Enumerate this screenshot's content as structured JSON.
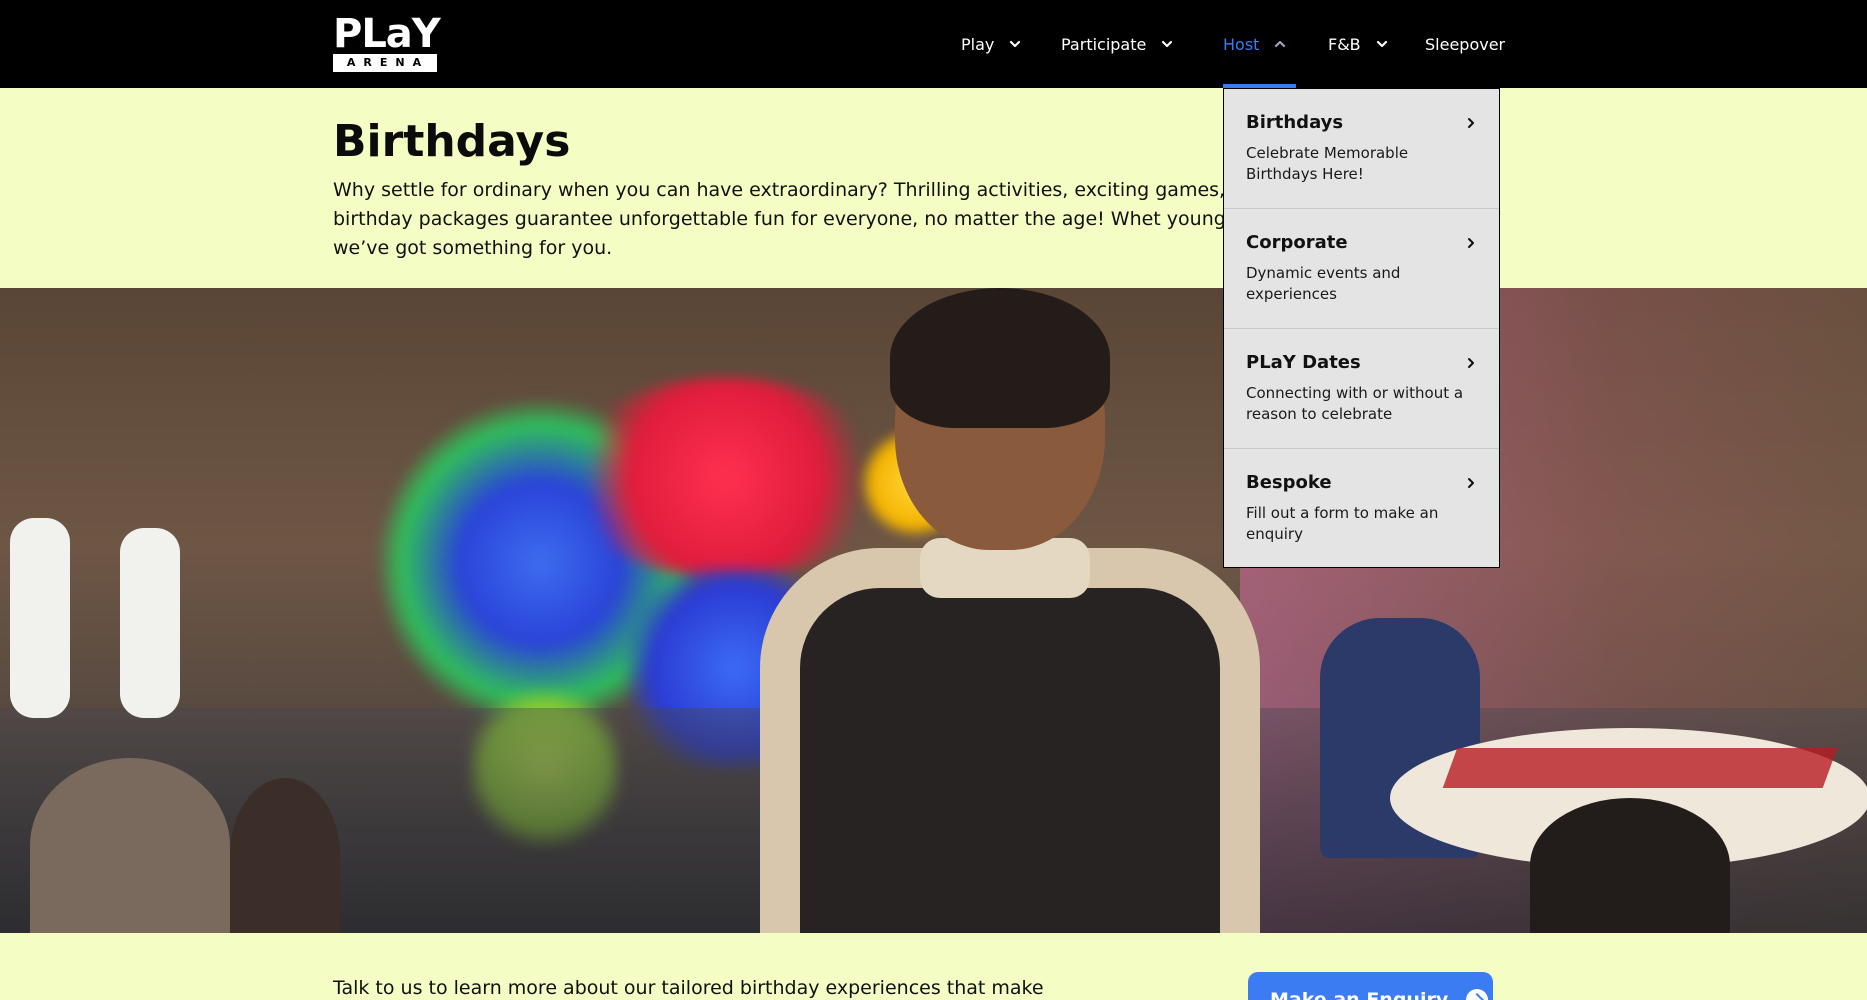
{
  "brand": {
    "logo_word": "PLaY",
    "logo_sub": "ARENA",
    "accent_color": "#3c7cf2",
    "background_color": "#f3fdc4",
    "header_color": "#000000"
  },
  "nav": {
    "items": [
      {
        "label": "Play",
        "has_dropdown": true,
        "active": false
      },
      {
        "label": "Participate",
        "has_dropdown": true,
        "active": false
      },
      {
        "label": "Host",
        "has_dropdown": true,
        "active": true
      },
      {
        "label": "F&B",
        "has_dropdown": true,
        "active": false
      },
      {
        "label": "Sleepover",
        "has_dropdown": false,
        "active": false
      }
    ]
  },
  "host_menu": {
    "items": [
      {
        "title": "Birthdays",
        "description": "Celebrate Memorable Birthdays Here!",
        "icon": "chevron-right-icon"
      },
      {
        "title": "Corporate",
        "description": "Dynamic events and experiences",
        "icon": "chevron-right-icon"
      },
      {
        "title": "PLaY Dates",
        "description": "Connecting with or without a reason to celebrate",
        "icon": "chevron-right-icon"
      },
      {
        "title": "Bespoke",
        "description": "Fill out a form to make an enquiry",
        "icon": "chevron-right-icon"
      }
    ]
  },
  "page": {
    "title": "Birthdays",
    "intro": "Why settle for ordinary when you can have extraordinary? Thrilling activities, exciting games, and d—our custom birthday packages guarantee unforgettable fun for everyone, no matter the age! Whet young or young at heart, we’ve got something for you.",
    "hero_alt": "birthday party photo",
    "bottom_text": "Talk to us to learn more about our tailored birthday experiences that make every",
    "cta_label": "Make an Enquiry"
  }
}
